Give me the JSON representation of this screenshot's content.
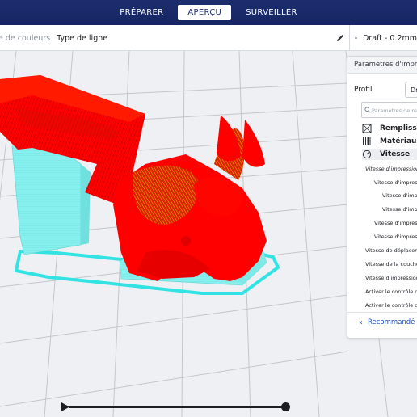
{
  "stages": {
    "prepare": "PRÉPARER",
    "preview": "APERÇU",
    "monitor": "SURVEILLER"
  },
  "view": {
    "color_scheme_label": "e de couleurs",
    "color_scheme_value": "Type de ligne"
  },
  "print_setup": {
    "label": "Draft - 0.2mm"
  },
  "panel": {
    "title": "Paramètres d'impr",
    "profile_label": "Profil",
    "profile_value": "Dr",
    "search_placeholder": "Paramètres de rec",
    "categories": {
      "infill": "Remplissa",
      "material": "Matériau",
      "speed": "Vitesse"
    },
    "settings": [
      "Vitesse d'impression",
      "Vitesse d'impress",
      "Vitesse d'imp",
      "Vitesse d'imp",
      "Vitesse d'impress",
      "Vitesse d'impress",
      "Vitesse de déplacem",
      "Vitesse de la couche",
      "Vitesse d'impression",
      "Activer le contrôle d'",
      "Activer le contrôle de"
    ],
    "recommended": "Recommandé"
  },
  "colors": {
    "topbar": "#1c2d6e",
    "model_red": "#ff0000",
    "support_cyan": "#7ff0f0",
    "skirt_cyan": "#33e3e3",
    "accent_yellow": "#c8f000",
    "link_blue": "#1c4fbf"
  },
  "icons": {
    "edit": "pencil-icon",
    "settings": "sliders-icon",
    "search": "search-icon",
    "play": "play-icon"
  },
  "slider": {
    "layer_fraction": 1.0
  }
}
